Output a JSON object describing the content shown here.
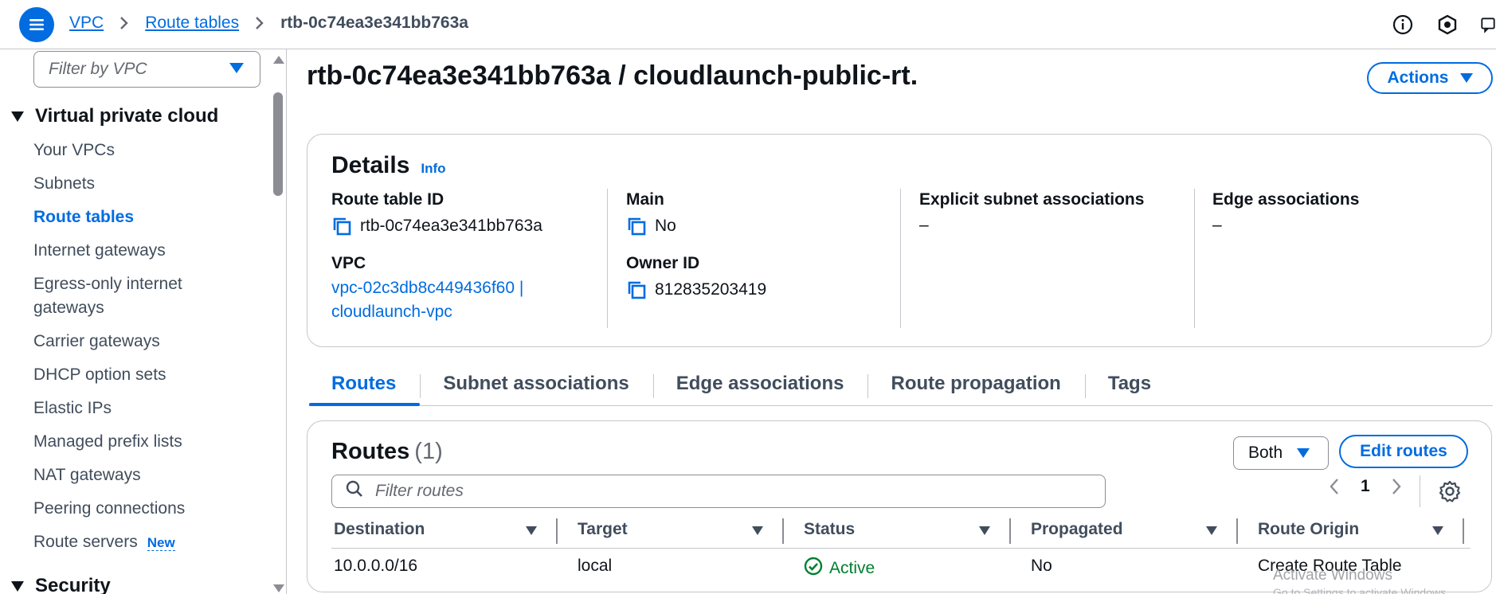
{
  "breadcrumb": {
    "root": "VPC",
    "parent": "Route tables",
    "current": "rtb-0c74ea3e341bb763a"
  },
  "sidebar": {
    "filter_placeholder": "Filter by VPC",
    "section_vpc": "Virtual private cloud",
    "items": [
      {
        "label": "Your VPCs"
      },
      {
        "label": "Subnets"
      },
      {
        "label": "Route tables"
      },
      {
        "label": "Internet gateways"
      },
      {
        "label": "Egress-only internet"
      },
      {
        "label": "gateways"
      },
      {
        "label": "Carrier gateways"
      },
      {
        "label": "DHCP option sets"
      },
      {
        "label": "Elastic IPs"
      },
      {
        "label": "Managed prefix lists"
      },
      {
        "label": "NAT gateways"
      },
      {
        "label": "Peering connections"
      },
      {
        "label": "Route servers"
      }
    ],
    "new_badge": "New",
    "section_security": "Security"
  },
  "page": {
    "title": "rtb-0c74ea3e341bb763a / cloudlaunch-public-rt.",
    "actions_label": "Actions"
  },
  "details": {
    "title": "Details",
    "info": "Info",
    "route_table_id_label": "Route table ID",
    "route_table_id": "rtb-0c74ea3e341bb763a",
    "vpc_label": "VPC",
    "vpc_line1": "vpc-02c3db8c449436f60 |",
    "vpc_line2": "cloudlaunch-vpc",
    "main_label": "Main",
    "main_value": "No",
    "owner_label": "Owner ID",
    "owner_value": "812835203419",
    "explicit_label": "Explicit subnet associations",
    "explicit_value": "–",
    "edge_label": "Edge associations",
    "edge_value": "–"
  },
  "tabs": [
    {
      "label": "Routes"
    },
    {
      "label": "Subnet associations"
    },
    {
      "label": "Edge associations"
    },
    {
      "label": "Route propagation"
    },
    {
      "label": "Tags"
    }
  ],
  "routes": {
    "title": "Routes",
    "count": "(1)",
    "filter_select": "Both",
    "edit_label": "Edit routes",
    "search_placeholder": "Filter routes",
    "page_number": "1",
    "columns": [
      "Destination",
      "Target",
      "Status",
      "Propagated",
      "Route Origin"
    ],
    "rows": [
      {
        "destination": "10.0.0.0/16",
        "target": "local",
        "status": "Active",
        "propagated": "No",
        "origin": "Create Route Table"
      }
    ]
  },
  "watermark": {
    "line1": "Activate Windows",
    "line2": "Go to Settings to activate Windows."
  },
  "colors": {
    "accent": "#006ce0",
    "success": "#00802f"
  }
}
